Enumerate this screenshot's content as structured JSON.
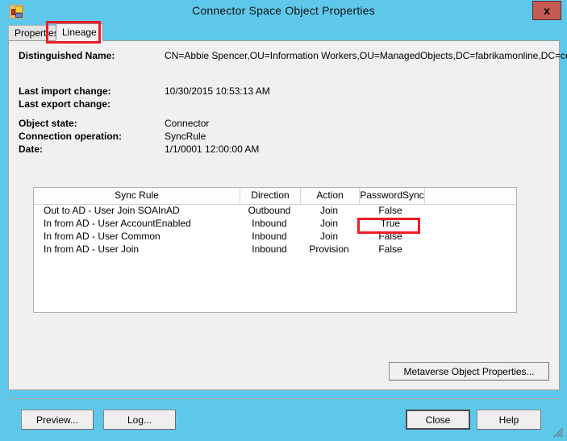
{
  "window": {
    "title": "Connector Space Object Properties",
    "app_icon": "connector-space-icon",
    "close_label": "x"
  },
  "tabs": [
    {
      "label": "Properties",
      "active": false
    },
    {
      "label": "Lineage",
      "active": true
    }
  ],
  "details": {
    "fields": [
      {
        "label": "Distinguished Name:",
        "value": "CN=Abbie Spencer,OU=Information Workers,OU=ManagedObjects,DC=fabrikamonline,DC=com"
      },
      {
        "label": "Last import change:",
        "value": "10/30/2015 10:53:13 AM"
      },
      {
        "label": "Last export change:",
        "value": ""
      },
      {
        "label": "Object state:",
        "value": "Connector"
      },
      {
        "label": "Connection operation:",
        "value": "SyncRule"
      },
      {
        "label": "Date:",
        "value": "1/1/0001 12:00:00 AM"
      }
    ]
  },
  "lineage_table": {
    "columns": [
      "Sync Rule",
      "Direction",
      "Action",
      "PasswordSync"
    ],
    "rows": [
      {
        "rule": "Out to AD - User Join SOAInAD",
        "direction": "Outbound",
        "action": "Join",
        "password_sync": "False"
      },
      {
        "rule": "In from AD - User AccountEnabled",
        "direction": "Inbound",
        "action": "Join",
        "password_sync": "True"
      },
      {
        "rule": "In from AD - User Common",
        "direction": "Inbound",
        "action": "Join",
        "password_sync": "False"
      },
      {
        "rule": "In from AD - User Join",
        "direction": "Inbound",
        "action": "Provision",
        "password_sync": "False"
      }
    ]
  },
  "buttons": {
    "metaverse": "Metaverse Object Properties...",
    "preview": "Preview...",
    "log": "Log...",
    "close": "Close",
    "help": "Help"
  },
  "annotations": {
    "tab_highlight": "Lineage",
    "value_highlight": "True"
  },
  "colors": {
    "titlebar": "#5ec8ea",
    "dialog": "#f0f0f0",
    "annotation": "#ee1c25",
    "close_button": "#c45a51"
  }
}
